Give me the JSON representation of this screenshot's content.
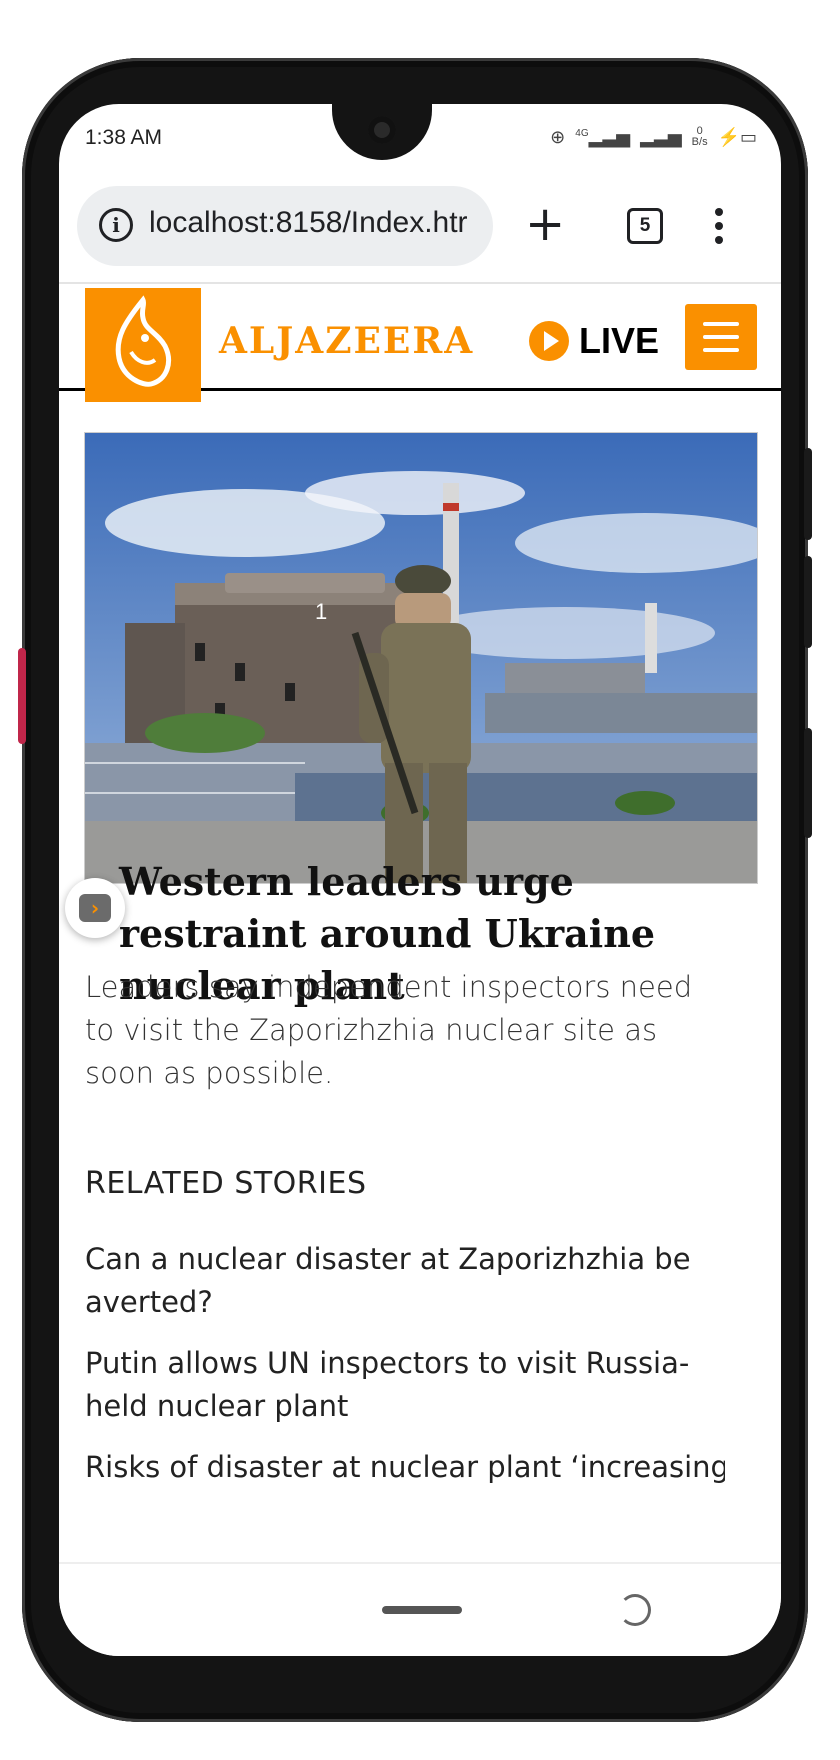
{
  "status": {
    "time": "1:38 AM",
    "network": "4G",
    "speed_value": "0",
    "speed_unit": "B/s"
  },
  "browser": {
    "url": "localhost:8158/Index.htr",
    "tab_count": "5"
  },
  "site": {
    "brand": "ALJAZEERA",
    "live_label": "LIVE",
    "accent_color": "#fa9000"
  },
  "article": {
    "headline": "Western leaders urge restraint around Ukraine nuclear plant",
    "summary": "Leaders say independent inspectors need to visit the Zaporizhzhia nuclear site as soon as possible."
  },
  "related": {
    "title": "RELATED STORIES",
    "items": [
      "Can a nuclear disaster at Zaporizhzhia be averted?",
      "Putin allows UN inspectors to visit Russia-held nuclear plant",
      "Risks of disaster at nuclear plant ‘increasing"
    ]
  }
}
